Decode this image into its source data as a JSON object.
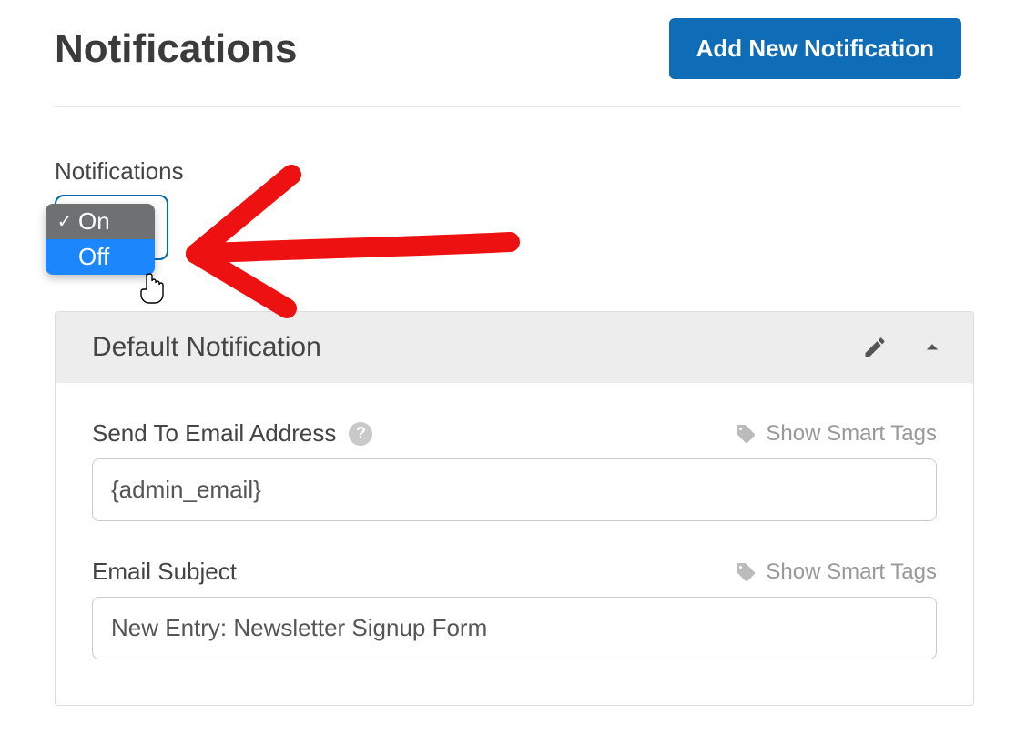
{
  "header": {
    "title": "Notifications",
    "add_button": "Add New Notification"
  },
  "toggle": {
    "label": "Notifications",
    "options": {
      "on": "On",
      "off": "Off"
    },
    "selected": "On",
    "hover": "Off"
  },
  "panel": {
    "title": "Default Notification",
    "fields": {
      "send_to": {
        "label": "Send To Email Address",
        "value": "{admin_email}",
        "smart_tags": "Show Smart Tags"
      },
      "subject": {
        "label": "Email Subject",
        "value": "New Entry: Newsletter Signup Form",
        "smart_tags": "Show Smart Tags"
      }
    }
  },
  "annotation": {
    "type": "hand-drawn-arrow",
    "color": "#ee1111"
  }
}
